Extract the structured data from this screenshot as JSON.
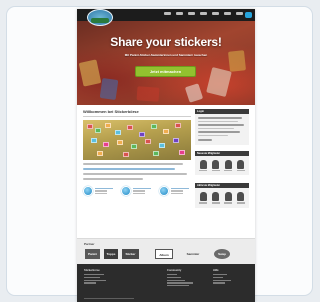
{
  "site": {
    "header": {
      "logo_icon": "globe-logo-icon",
      "nav_cta_icon": "user-icon"
    },
    "hero": {
      "title": "Share your stickers!",
      "subtitle": "Mit Panini-Sticker-Sammlerinnen und Sammlern tauschen",
      "button_label": "Jetzt mitmachen"
    },
    "main": {
      "title": "Willkommen bei Stickerbörse"
    },
    "sidebar": {
      "box1_title": "Login",
      "gallery1_title": "Neueste Mitglieder",
      "gallery2_title": "Aktivste Mitglieder"
    },
    "partners": {
      "label": "Partner",
      "logos": [
        "Panini",
        "Topps",
        "Sticker",
        "Album",
        "Sammler",
        "Swap"
      ]
    },
    "footer": {
      "columns": [
        "Stickerbörse",
        "Community",
        "Hilfe"
      ]
    },
    "colors": {
      "accent_green": "#92c12f",
      "nav_blue": "#26a4dc",
      "dark": "#1c1c1c"
    }
  }
}
